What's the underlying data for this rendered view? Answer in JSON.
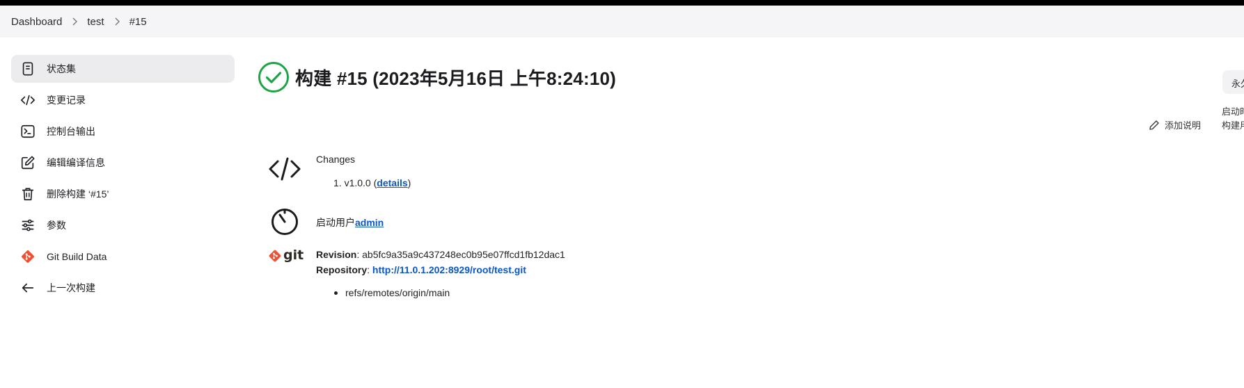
{
  "breadcrumb": {
    "items": [
      "Dashboard",
      "test",
      "#15"
    ]
  },
  "sidebar": {
    "items": [
      {
        "label": "状态集",
        "icon": "document-icon",
        "active": true
      },
      {
        "label": "变更记录",
        "icon": "code-icon"
      },
      {
        "label": "控制台输出",
        "icon": "terminal-icon"
      },
      {
        "label": "编辑编译信息",
        "icon": "edit-icon"
      },
      {
        "label": "删除构建 ‘#15’",
        "icon": "trash-icon"
      },
      {
        "label": "参数",
        "icon": "sliders-icon"
      },
      {
        "label": "Git Build Data",
        "icon": "git-logo-icon"
      },
      {
        "label": "上一次构建",
        "icon": "arrow-left-icon"
      }
    ]
  },
  "build": {
    "title": "构建 #15 (2023年5月16日 上午8:24:10)",
    "status": "success",
    "status_color": "#1ea446"
  },
  "actions": {
    "add_description": "添加说明"
  },
  "right_panel": {
    "chip_text": "永久",
    "line1": "启动时",
    "line2": "构建用"
  },
  "changes": {
    "title": "Changes",
    "item_number": "1.",
    "item_version": "v1.0.0",
    "item_link_label": "details"
  },
  "started_by": {
    "prefix": "启动用户",
    "user": "admin"
  },
  "git": {
    "logo_text": "git",
    "revision_label": "Revision",
    "revision_value": "ab5fc9a35a9c437248ec0b95e07ffcd1fb12dac1",
    "repository_label": "Repository",
    "repository_url": "http://11.0.1.202:8929/root/test.git",
    "branch": "refs/remotes/origin/main",
    "brand_color": "#f05033"
  },
  "colors": {
    "link": "#0b57c5",
    "sidebar_active_bg": "#ececef",
    "breadcrumb_bg": "#f5f5f7"
  }
}
